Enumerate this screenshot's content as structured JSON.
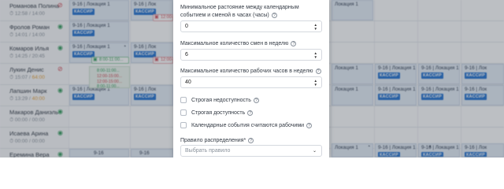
{
  "employees": [
    {
      "name": "Романова Полина",
      "stats": "12:58 / 14:00",
      "warn": "",
      "visible": false
    },
    {
      "name": "Фролов Роман",
      "stats": "14:01 / 14:00",
      "warn": "",
      "visible": true
    },
    {
      "name": "Комаров Илья",
      "stats": "14:25 / 20:45",
      "warn": "",
      "visible": true
    },
    {
      "name": "Лукин Денис",
      "stats": "15:07 / ",
      "warn": "64:00",
      "visible": false
    },
    {
      "name": "Лапшин Марк",
      "stats": "13:29 / ",
      "warn": "40:00",
      "visible": true
    },
    {
      "name": "Макаров Даниэль",
      "stats": "00:00 / 00:00",
      "warn": "",
      "visible": true
    },
    {
      "name": "Исаева Арина",
      "stats": "00:00 / 00:00",
      "warn": "",
      "visible": true
    },
    {
      "name": "Еремина Вера",
      "stats": "",
      "warn": "",
      "visible": true
    }
  ],
  "shift": {
    "time": "9-16",
    "location": "Локация 1",
    "short_location": "Лок",
    "badge": "КАССИР"
  },
  "events": {
    "e1": "12:00-15:00...",
    "e2": "8:00-11:00...",
    "e3": "12:00-15:...",
    "e4": "8:00-11:00...",
    "e5": "12:00-15:00...",
    "e6": "8:00-11:00...",
    "p1": "8:00-11:00...",
    "p2": "12:00-15:00...",
    "p3": "12:00-15:00...",
    "p4": "8:00-11:00..."
  },
  "modal": {
    "fields": [
      {
        "label": "Минимальное растояние между календарным событием и сменой в часах (часы)",
        "value": "0"
      },
      {
        "label": "Максимальное количество смен в неделю",
        "value": "6"
      },
      {
        "label": "Максимальное количество рабочих часов в неделю",
        "value": "40"
      }
    ],
    "checkboxes": [
      {
        "label": "Строгая недоступность"
      },
      {
        "label": "Строгая доступность"
      },
      {
        "label": "Календарные события считаются рабочими"
      }
    ],
    "distribution": {
      "label": "Правило распределения",
      "required": "*",
      "placeholder": "Выбрать правило"
    }
  },
  "colors": {
    "accent": "#1e6fd0",
    "eye_on": "#2f9a58",
    "eye_off": "#d2434f",
    "warning": "#e8a23a"
  }
}
